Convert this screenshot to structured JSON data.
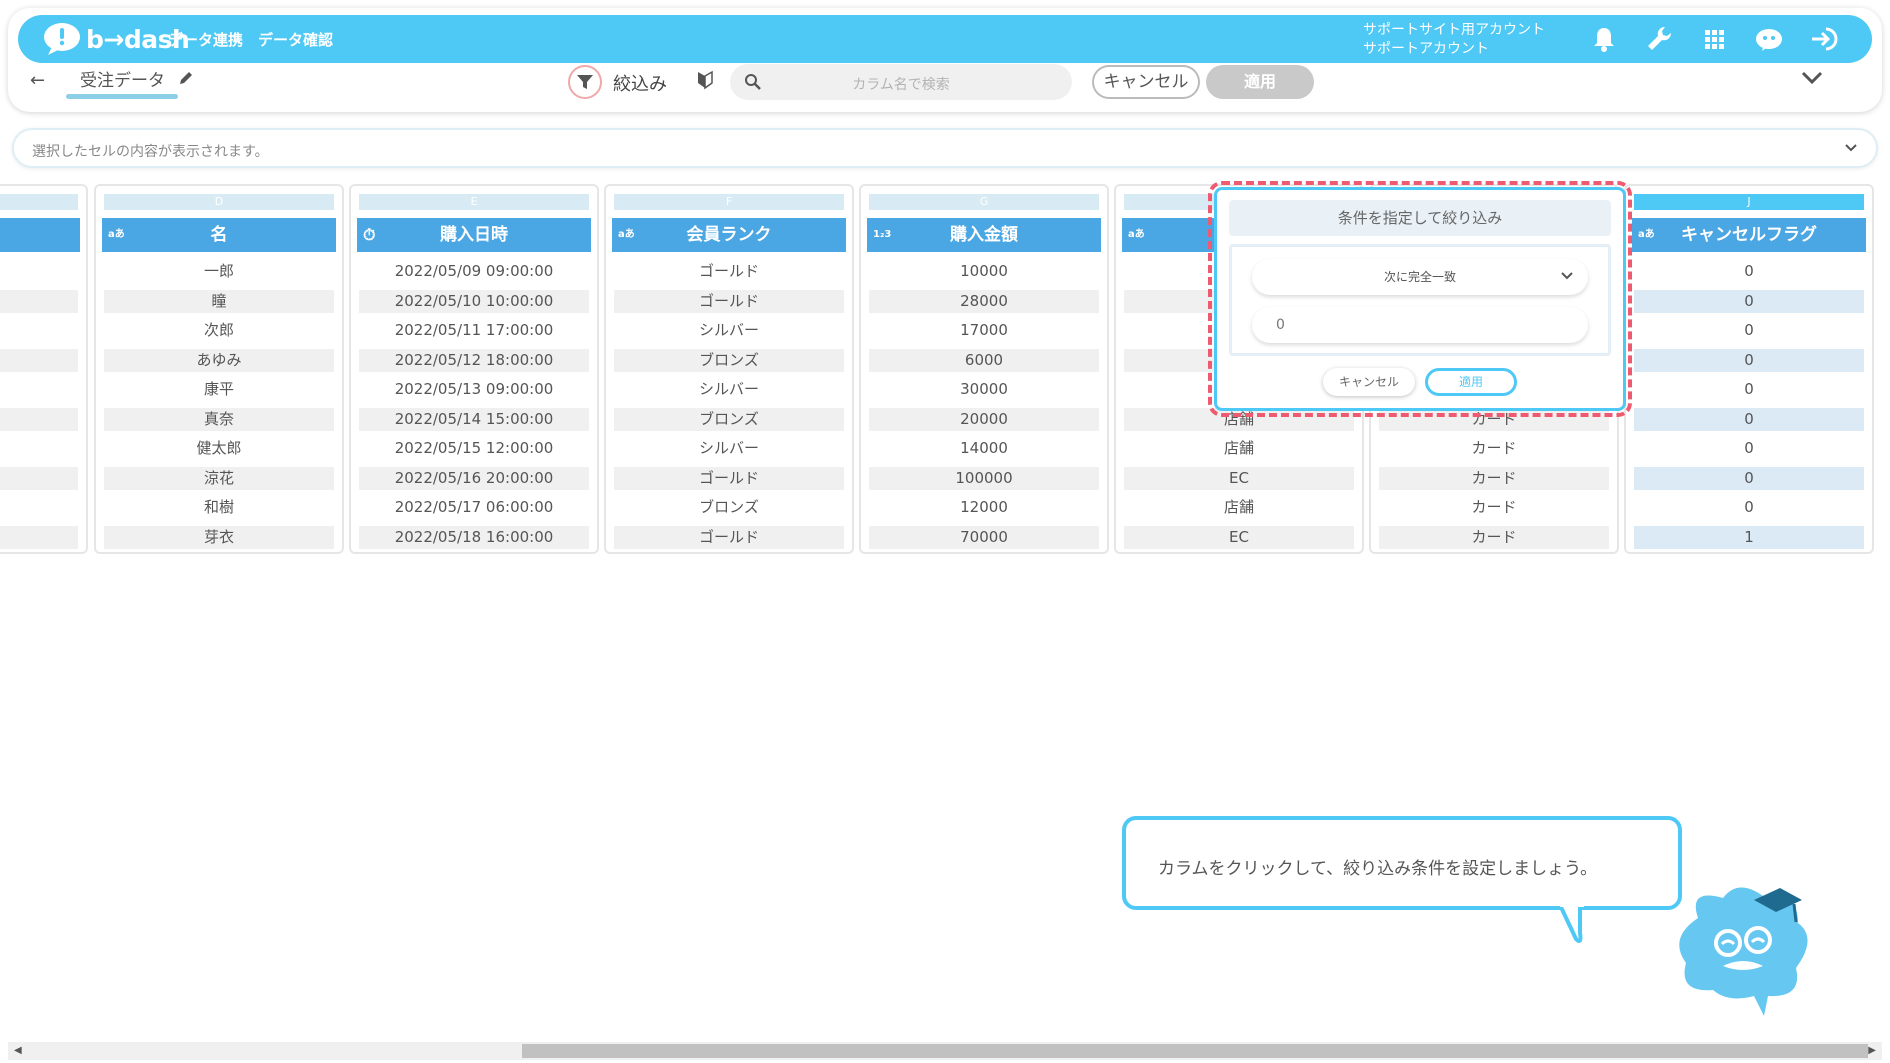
{
  "app": {
    "logo_text": "b→dash",
    "nav": [
      "データ連携",
      "データ確認"
    ],
    "account_line1": "サポートサイト用アカウント",
    "account_line2": "サポートアカウント"
  },
  "subbar": {
    "back_icon": "←",
    "data_name": "受注データ",
    "filter_label": "絞込み",
    "search_placeholder": "カラム名で検索",
    "cancel_label": "キャンセル",
    "apply_label": "適用"
  },
  "cellbar": {
    "placeholder": "選択したセルの内容が表示されます。"
  },
  "columns": [
    {
      "letter": "",
      "name": "",
      "type_icon": "",
      "cells": [
        "",
        "",
        "",
        "",
        "",
        "",
        "",
        "",
        "",
        ""
      ]
    },
    {
      "letter": "D",
      "name": "名",
      "type_icon": "aあ",
      "cells": [
        "一郎",
        "瞳",
        "次郎",
        "あゆみ",
        "康平",
        "真奈",
        "健太郎",
        "涼花",
        "和樹",
        "芽衣"
      ]
    },
    {
      "letter": "E",
      "name": "購入日時",
      "type_icon": "⏱",
      "cells": [
        "2022/05/09 09:00:00",
        "2022/05/10 10:00:00",
        "2022/05/11 17:00:00",
        "2022/05/12 18:00:00",
        "2022/05/13 09:00:00",
        "2022/05/14 15:00:00",
        "2022/05/15 12:00:00",
        "2022/05/16 20:00:00",
        "2022/05/17 06:00:00",
        "2022/05/18 16:00:00"
      ]
    },
    {
      "letter": "F",
      "name": "会員ランク",
      "type_icon": "aあ",
      "cells": [
        "ゴールド",
        "ゴールド",
        "シルバー",
        "ブロンズ",
        "シルバー",
        "ブロンズ",
        "シルバー",
        "ゴールド",
        "ブロンズ",
        "ゴールド"
      ]
    },
    {
      "letter": "G",
      "name": "購入金額",
      "type_icon": "1₂3",
      "cells": [
        "10000",
        "28000",
        "17000",
        "6000",
        "30000",
        "20000",
        "14000",
        "100000",
        "12000",
        "70000"
      ]
    },
    {
      "letter": "",
      "name": "",
      "type_icon": "aあ",
      "cells": [
        "",
        "",
        "",
        "",
        "",
        "店舗",
        "店舗",
        "EC",
        "店舗",
        "EC"
      ]
    },
    {
      "letter": "",
      "name": "",
      "type_icon": "",
      "cells": [
        "",
        "",
        "",
        "",
        "",
        "カード",
        "カード",
        "カード",
        "カード",
        "カード"
      ]
    },
    {
      "letter": "J",
      "name": "キャンセルフラグ",
      "type_icon": "aあ",
      "cells": [
        "0",
        "0",
        "0",
        "0",
        "0",
        "0",
        "0",
        "0",
        "0",
        "1"
      ]
    }
  ],
  "filter_popup": {
    "title": "条件を指定して絞り込み",
    "condition": "次に完全一致",
    "value": "0",
    "cancel_label": "キャンセル",
    "apply_label": "適用"
  },
  "tip": {
    "text": "カラムをクリックして、絞り込み条件を設定しましょう。"
  },
  "colors": {
    "brand": "#4ec8f4",
    "header": "#4ba6e4",
    "highlight": "#ee5a6f"
  }
}
